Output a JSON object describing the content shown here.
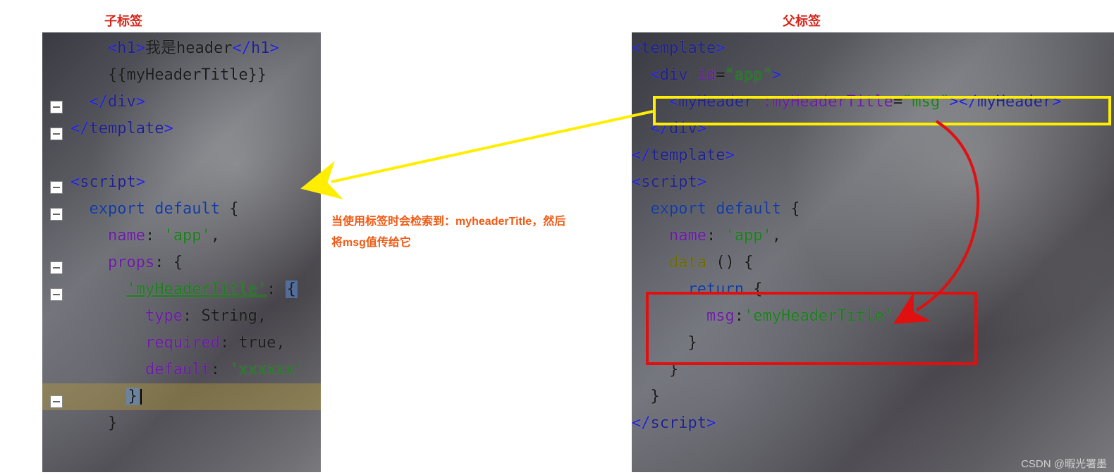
{
  "labels": {
    "child": "子标签",
    "parent": "父标签"
  },
  "annotation": {
    "line1": "当使用标签时会检索到：myheaderTitle，然后",
    "line2": "将msg值传给它"
  },
  "watermark": "CSDN @暇光署墨",
  "child_code": {
    "l1_1": "<",
    "l1_2": "h1",
    "l1_3": ">",
    "l1_4": "我是header",
    "l1_5": "</",
    "l1_6": "h1",
    "l1_7": ">",
    "l2": "{{myHeaderTitle}}",
    "l3_1": "</",
    "l3_2": "div",
    "l3_3": ">",
    "l4_1": "</",
    "l4_2": "template",
    "l4_3": ">",
    "l6_1": "<",
    "l6_2": "script",
    "l6_3": ">",
    "l7_1": "export",
    "l7_2": " default",
    "l7_3": " {",
    "l8_1": "name",
    "l8_2": ": ",
    "l8_3": "'app'",
    "l8_4": ",",
    "l9_1": "props",
    "l9_2": ": {",
    "l10_1": "'myHeaderTitle'",
    "l10_2": ": ",
    "l10_3": "{",
    "l11_1": "type",
    "l11_2": ": String,",
    "l12_1": "required",
    "l12_2": ": true,",
    "l13_1": "default",
    "l13_2": ": ",
    "l13_3": "'xxxxxx'",
    "l14": "}",
    "l15": "}"
  },
  "parent_code": {
    "l1_1": "<",
    "l1_2": "template",
    "l1_3": ">",
    "l2_1": "<",
    "l2_2": "div",
    "l2_3": " id",
    "l2_4": "=",
    "l2_5": "\"app\"",
    "l2_6": ">",
    "l3_1": "<",
    "l3_2": "myHeader",
    "l3_3": " :myHeaderTitle",
    "l3_4": "=",
    "l3_5": "\"msg\"",
    "l3_6": "></",
    "l3_7": "myHeader",
    "l3_8": ">",
    "l4_1": "</",
    "l4_2": "div",
    "l4_3": ">",
    "l5_1": "</",
    "l5_2": "template",
    "l5_3": ">",
    "l6_1": "<",
    "l6_2": "script",
    "l6_3": ">",
    "l7_1": "export",
    "l7_2": " default",
    "l7_3": " {",
    "l8_1": "name",
    "l8_2": ": ",
    "l8_3": "'app'",
    "l8_4": ",",
    "l9_1": "data",
    "l9_2": " () {",
    "l10_1": "return",
    "l10_2": " {",
    "l11_1": "msg",
    "l11_2": ":",
    "l11_3": "'emyHeaderTitle'",
    "l12": "}",
    "l13": "}",
    "l14": "}",
    "l15_1": "</",
    "l15_2": "script",
    "l15_3": ">"
  }
}
